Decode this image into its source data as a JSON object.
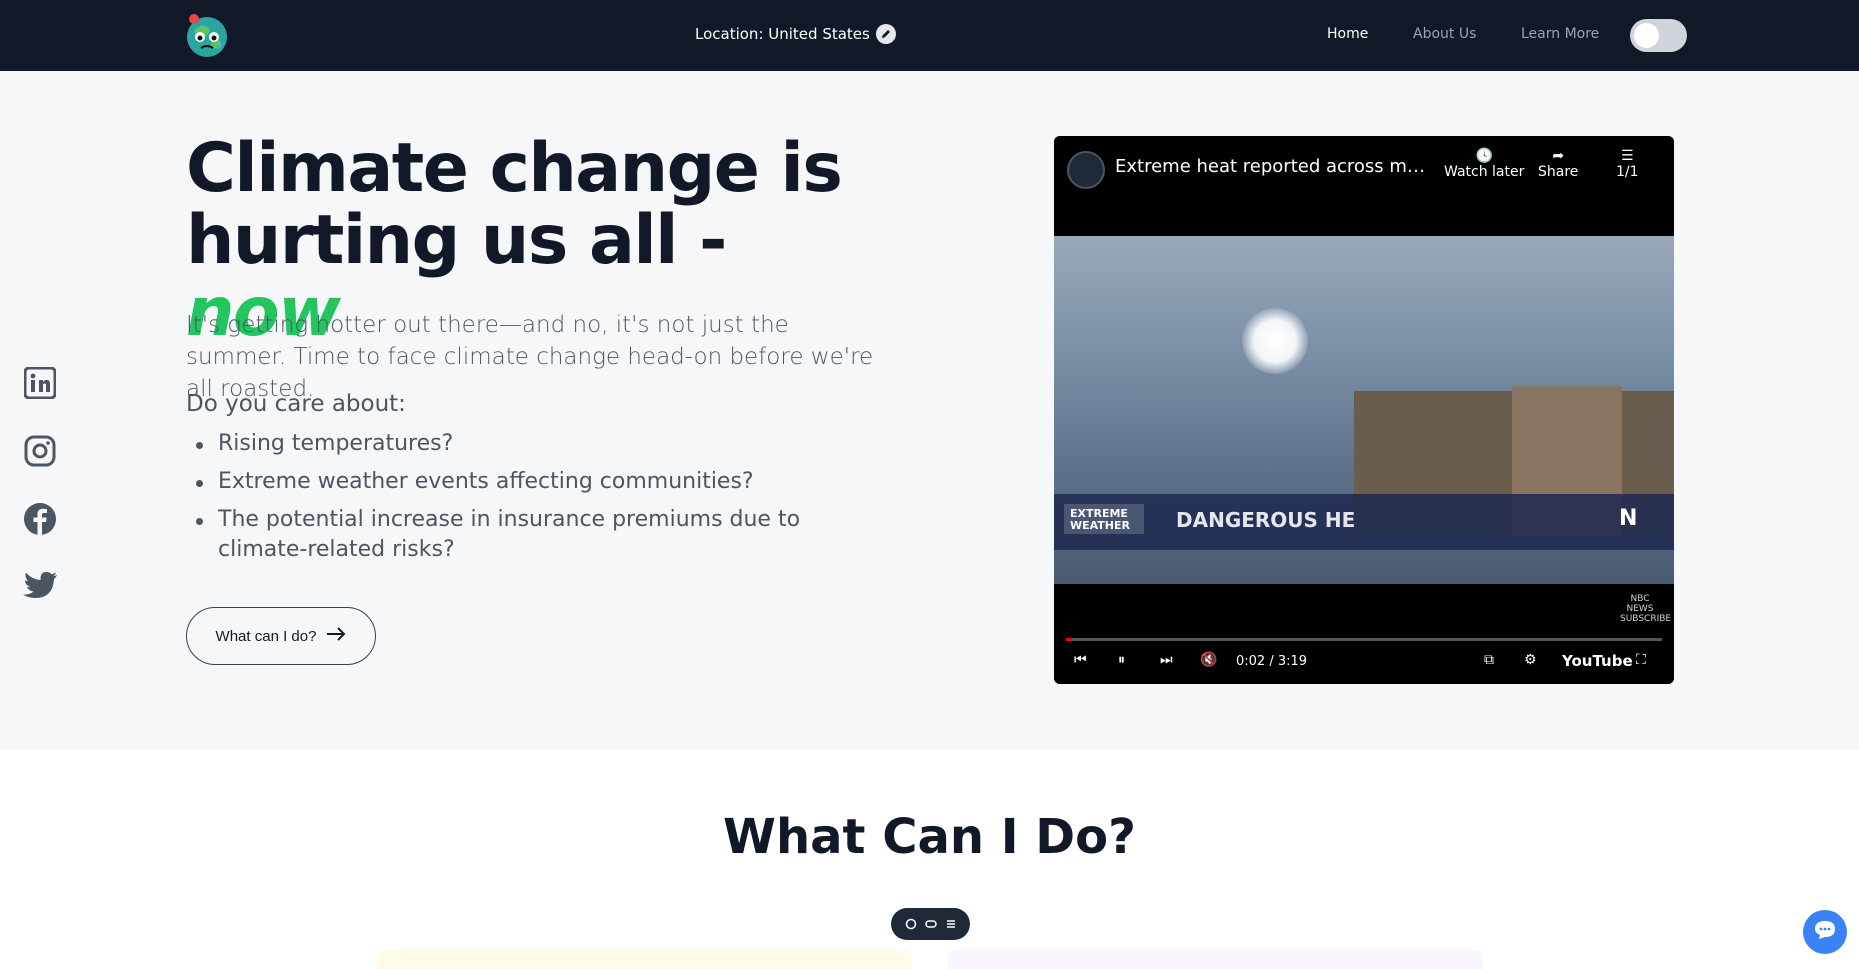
{
  "nav": {
    "location_label": "Location: United States",
    "links": [
      "Home",
      "About Us",
      "Learn More"
    ]
  },
  "hero": {
    "title_main": "Climate change is hurting us all - ",
    "title_accent": "now",
    "intro": "It's getting hotter out there—and no, it's not just the summer. Time to face climate change head-on before we're all roasted.",
    "question": "Do you care about:",
    "bullets": [
      "Rising temperatures?",
      "Extreme weather events affecting communities?",
      "The potential increase in insurance premiums due to climate-related risks?"
    ],
    "cta": "What can I do?"
  },
  "social": [
    "linkedin-icon",
    "instagram-icon",
    "facebook-icon",
    "twitter-icon"
  ],
  "video": {
    "title": "Extreme heat reported across multiple...",
    "actions": [
      "Watch later",
      "Share",
      "1/1"
    ],
    "lower_third_tag": "EXTREME WEATHER",
    "lower_third_text": "DANGEROUS HE",
    "corner_logo": "NBC NEWS SUBSCRIBE",
    "time": "0:02 / 3:19",
    "brand": "YouTube",
    "progress": 0.01
  },
  "section": {
    "heading": "What Can I Do?"
  },
  "colors": {
    "nav_bg": "#111827",
    "accent_green": "#22c55e",
    "chat_blue": "#3b82f6"
  }
}
